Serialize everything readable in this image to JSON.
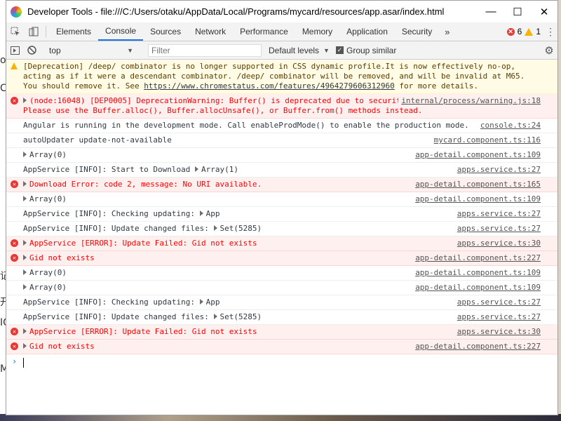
{
  "window": {
    "title": "Developer Tools - file:///C:/Users/otaku/AppData/Local/Programs/mycard/resources/app.asar/index.html"
  },
  "tabs": [
    {
      "label": "Elements",
      "active": false
    },
    {
      "label": "Console",
      "active": true
    },
    {
      "label": "Sources",
      "active": false
    },
    {
      "label": "Network",
      "active": false
    },
    {
      "label": "Performance",
      "active": false
    },
    {
      "label": "Memory",
      "active": false
    },
    {
      "label": "Application",
      "active": false
    },
    {
      "label": "Security",
      "active": false
    }
  ],
  "counts": {
    "errors": "6",
    "warnings": "1"
  },
  "toolbar": {
    "context": "top",
    "filter_placeholder": "Filter",
    "levels": "Default levels",
    "group_similar": "Group similar"
  },
  "messages": [
    {
      "level": "warn",
      "text": "[Deprecation] /deep/ combinator is no longer supported in CSS dynamic profile.It is now effectively no-op, acting as if it were a descendant combinator. /deep/ combinator will be removed, and will be invalid at M65. You should remove it. See ",
      "link": "https://www.chromestatus.com/features/4964279606312960",
      "after": " for more details.",
      "source": ""
    },
    {
      "level": "error",
      "expand": true,
      "text": "(node:16048) [DEP0005] DeprecationWarning: Buffer() is deprecated due to security and usability issues. Please use the Buffer.alloc(), Buffer.allocUnsafe(), or Buffer.from() methods instead.",
      "source": "internal/process/warning.js:18"
    },
    {
      "level": "info",
      "text": "Angular is running in the development mode. Call enableProdMode() to enable the production mode.",
      "source": "console.ts:24"
    },
    {
      "level": "info",
      "text": "autoUpdater update-not-available",
      "source": "mycard.component.ts:116"
    },
    {
      "level": "info",
      "expand": true,
      "text": "Array(0)",
      "source": "app-detail.component.ts:109"
    },
    {
      "level": "info",
      "text": "AppService [INFO]:  Start to Download ",
      "obj": "Array(1)",
      "source": "apps.service.ts:27"
    },
    {
      "level": "error",
      "expand": true,
      "text": "Download Error: code 2, message: No URI available.",
      "source": "app-detail.component.ts:165"
    },
    {
      "level": "info",
      "expand": true,
      "text": "Array(0)",
      "source": "app-detail.component.ts:109"
    },
    {
      "level": "info",
      "text": "AppService [INFO]:  Checking updating: ",
      "obj": "App",
      "source": "apps.service.ts:27"
    },
    {
      "level": "info",
      "text": "AppService [INFO]:  Update changed files: ",
      "obj": "Set(5285)",
      "source": "apps.service.ts:27"
    },
    {
      "level": "error",
      "expand": true,
      "text": "AppService [ERROR]:  Update Failed:  Gid not exists",
      "source": "apps.service.ts:30"
    },
    {
      "level": "error",
      "expand": true,
      "text": "Gid not exists",
      "source": "app-detail.component.ts:227"
    },
    {
      "level": "info",
      "expand": true,
      "text": "Array(0)",
      "source": "app-detail.component.ts:109"
    },
    {
      "level": "info",
      "expand": true,
      "text": "Array(0)",
      "source": "app-detail.component.ts:109"
    },
    {
      "level": "info",
      "text": "AppService [INFO]:  Checking updating: ",
      "obj": "App",
      "source": "apps.service.ts:27"
    },
    {
      "level": "info",
      "text": "AppService [INFO]:  Update changed files: ",
      "obj": "Set(5285)",
      "source": "apps.service.ts:27"
    },
    {
      "level": "error",
      "expand": true,
      "text": "AppService [ERROR]:  Update Failed:  Gid not exists",
      "source": "apps.service.ts:30"
    },
    {
      "level": "error",
      "expand": true,
      "text": "Gid not exists",
      "source": "app-detail.component.ts:227"
    }
  ],
  "background_left_chars": [
    "o",
    "C",
    "记",
    "开",
    "IC",
    "M"
  ],
  "colors": {
    "accent": "#1a73e8",
    "error": "#ff0000",
    "error_bg": "#fff0f0",
    "warn_bg": "#fffbe5"
  }
}
